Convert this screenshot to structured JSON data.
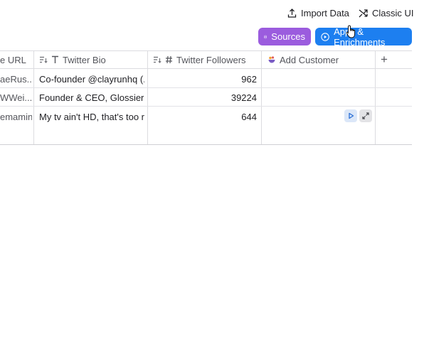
{
  "toolbar": {
    "import_label": "Import Data",
    "classic_label": "Classic UI",
    "sources_label": "Sources",
    "apps_label": "Apps & Enrichments"
  },
  "columns": [
    {
      "label": "e URL",
      "icon": "none"
    },
    {
      "label": "Twitter Bio",
      "icon": "text-icon"
    },
    {
      "label": "Twitter Followers",
      "icon": "hash-icon"
    },
    {
      "label": "Add Customer",
      "icon": "enrichment-icon"
    },
    {
      "label": "+",
      "icon": "plus-icon"
    }
  ],
  "rows": [
    {
      "url": "aeRus...",
      "bio": "Co-founder @clayrunhq (...",
      "followers": "962",
      "customer": ""
    },
    {
      "url": "WWei...",
      "bio": "Founder & CEO, Glossier Inc",
      "followers": "39224",
      "customer": ""
    },
    {
      "url": "emamin",
      "bio": "My tv ain't HD, that's too r...",
      "followers": "644",
      "customer": ""
    }
  ],
  "colors": {
    "sources": "#9b5cde",
    "apps": "#1d7ff0",
    "border": "#dcdce0"
  }
}
